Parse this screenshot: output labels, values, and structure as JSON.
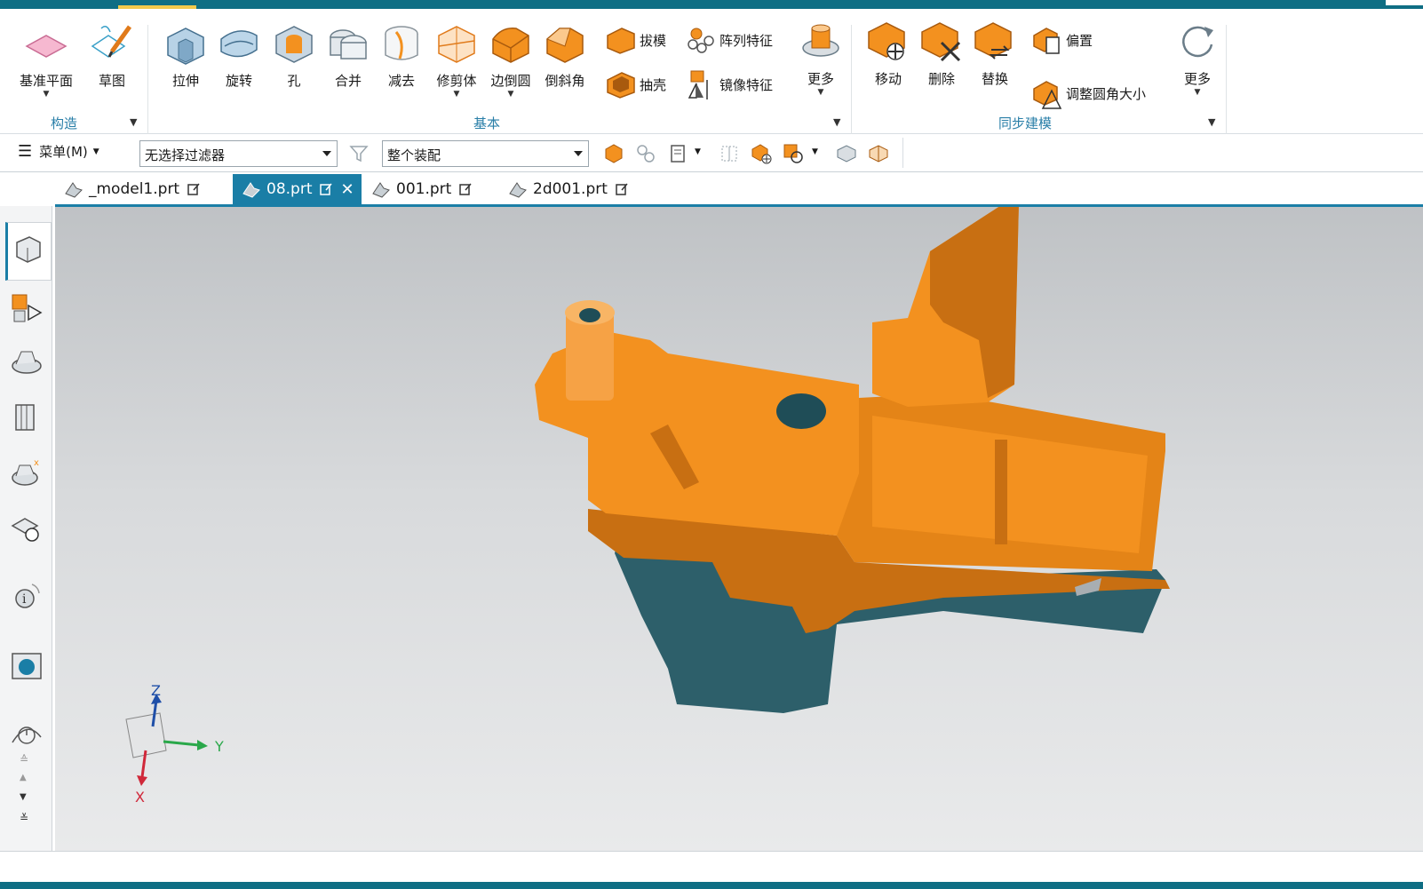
{
  "ribbon": {
    "construct": {
      "group_label": "构造",
      "datum_plane": "基准平面",
      "sketch": "草图"
    },
    "basic": {
      "group_label": "基本",
      "extrude": "拉伸",
      "revolve": "旋转",
      "hole": "孔",
      "unite": "合并",
      "subtract": "减去",
      "trim_body": "修剪体",
      "edge_blend": "边倒圆",
      "chamfer": "倒斜角",
      "draft": "拔模",
      "shell": "抽壳",
      "pattern_feature": "阵列特征",
      "mirror_feature": "镜像特征",
      "more": "更多"
    },
    "sync": {
      "group_label": "同步建模",
      "move": "移动",
      "delete": "删除",
      "replace": "替换",
      "offset": "偏置",
      "resize_blend": "调整圆角大小",
      "more": "更多"
    }
  },
  "selection_bar": {
    "menu_label": "菜单(M)",
    "filter_value": "无选择过滤器",
    "scope_value": "整个装配"
  },
  "tabs": [
    {
      "label": "_model1.prt"
    },
    {
      "label": "08.prt"
    },
    {
      "label": "001.prt"
    },
    {
      "label": "2d001.prt"
    }
  ],
  "triad": {
    "z": "Z",
    "y": "Y",
    "x": "X"
  },
  "colors": {
    "accent": "#1a7ea6",
    "part_orange": "#f3911f",
    "part_teal": "#2d5f6a",
    "group_label": "#2a7fa8"
  },
  "icons": {
    "gear": "gear-icon",
    "part_file": "part-file-icon",
    "edit": "edit-icon",
    "close": "close-icon"
  }
}
